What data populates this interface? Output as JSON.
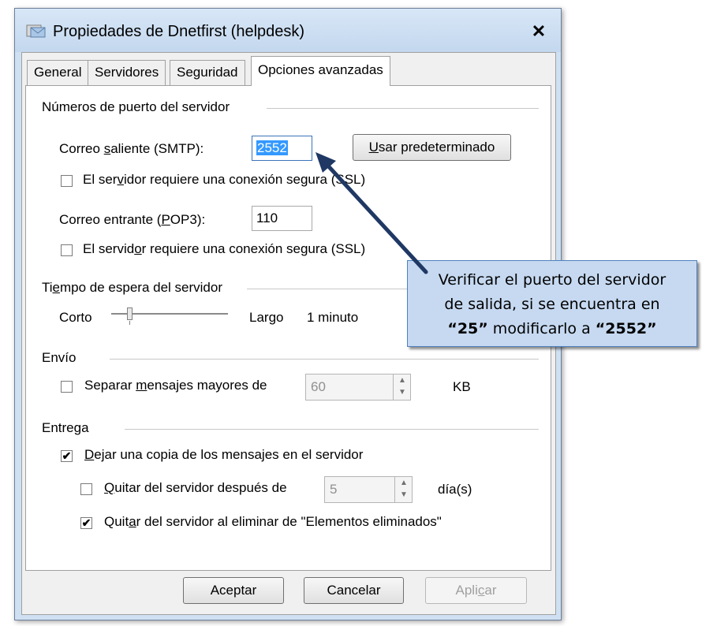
{
  "window": {
    "title": "Propiedades de Dnetfirst (helpdesk)",
    "close_label": "✕"
  },
  "tabs": [
    {
      "label": "General",
      "active": false
    },
    {
      "label": "Servidores",
      "active": false
    },
    {
      "label": "Seguridad",
      "active": false
    },
    {
      "label": "Opciones avanzadas",
      "active": true
    }
  ],
  "ports": {
    "group_title": "Números de puerto del servidor",
    "smtp_label": "Correo saliente (SMTP):",
    "smtp_value": "2552",
    "default_button": "Usar predeterminado",
    "smtp_ssl_label": "El servidor requiere una conexión segura (SSL)",
    "smtp_ssl_checked": false,
    "pop3_label": "Correo entrante (POP3):",
    "pop3_value": "110",
    "pop3_ssl_label": "El servidor requiere una conexión segura (SSL)",
    "pop3_ssl_checked": false
  },
  "timeout": {
    "group_title": "Tiempo de espera del servidor",
    "short_label": "Corto",
    "long_label": "Largo",
    "value_label": "1 minuto"
  },
  "sending": {
    "group_title": "Envío",
    "split_label": "Separar mensajes mayores de",
    "split_checked": false,
    "split_value": "60",
    "split_unit": "KB"
  },
  "delivery": {
    "group_title": "Entrega",
    "leave_copy_label": "Dejar una copia de los mensajes en el servidor",
    "leave_copy_checked": true,
    "remove_after_label": "Quitar del servidor después de",
    "remove_after_checked": false,
    "remove_after_value": "5",
    "remove_after_unit": "día(s)",
    "remove_deleted_label": "Quitar del servidor al eliminar de \"Elementos eliminados\"",
    "remove_deleted_checked": true
  },
  "buttons": {
    "accept": "Aceptar",
    "cancel": "Cancelar",
    "apply": "Aplicar"
  },
  "callout": {
    "line1": "Verificar el puerto del servidor",
    "line2": "de salida, si se encuentra en",
    "q1": "“25”",
    "mid": " modificarlo a ",
    "q2": "“2552”"
  },
  "colors": {
    "selection": "#3399ff",
    "callout_fill": "#c6d9f1",
    "callout_border": "#4f81bd",
    "arrow": "#1f3864"
  }
}
